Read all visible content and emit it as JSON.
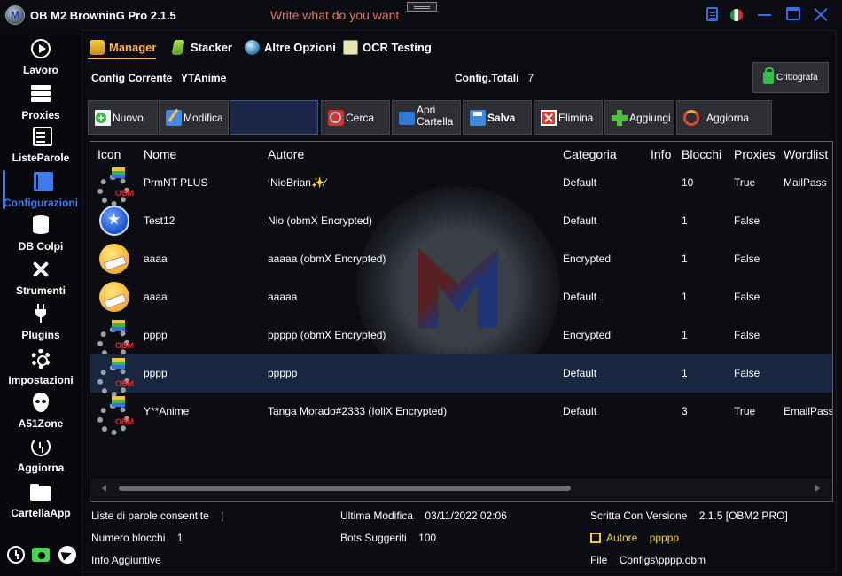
{
  "window": {
    "title": "OB M2 BrowninG Pro  2.1.5",
    "search_placeholder": "Write what do you want"
  },
  "sidebar": {
    "items": [
      {
        "label": "Lavoro",
        "icon": "play-icon"
      },
      {
        "label": "Proxies",
        "icon": "server-icon"
      },
      {
        "label": "ListeParole",
        "icon": "list-icon"
      },
      {
        "label": "Configurazioni",
        "icon": "book-icon",
        "active": true
      },
      {
        "label": "DB Colpi",
        "icon": "database-icon"
      },
      {
        "label": "Strumenti",
        "icon": "tools-icon"
      },
      {
        "label": "Plugins",
        "icon": "plug-icon"
      },
      {
        "label": "Impostazioni",
        "icon": "gear-icon"
      },
      {
        "label": "A51Zone",
        "icon": "alien-icon"
      },
      {
        "label": "Aggiorna",
        "icon": "update-icon"
      },
      {
        "label": "CartellaApp",
        "icon": "folder-icon"
      }
    ],
    "bottom_icons": [
      "history-icon",
      "camera-icon",
      "telegram-icon"
    ]
  },
  "tabs": [
    {
      "label": "Manager",
      "icon": "manager-icon",
      "active": true
    },
    {
      "label": "Stacker",
      "icon": "stacker-icon"
    },
    {
      "label": "Altre Opzioni",
      "icon": "globe-icon"
    },
    {
      "label": "OCR Testing",
      "icon": "ocr-icon"
    }
  ],
  "config": {
    "current_label": "Config Corrente",
    "current_value": "YTAnime",
    "total_label": "Config.Totali",
    "total_value": "7",
    "encrypt_label": "Crittografa"
  },
  "toolbar": {
    "nuovo": "Nuovo",
    "modifica": "Modifica",
    "cerca": "Cerca",
    "apri_line1": "Apri",
    "apri_line2": "Cartella",
    "salva": "Salva",
    "elimina": "Elimina",
    "aggiungi": "Aggiungi",
    "aggiorna": "Aggiorna"
  },
  "table": {
    "headers": {
      "icon": "Icon",
      "name": "Nome",
      "author": "Autore",
      "category": "Categoria",
      "info": "Info",
      "blocks": "Blocchi",
      "proxies": "Proxies",
      "wordlist": "Wordlist"
    },
    "rows": [
      {
        "icon": "obm-gear-icon",
        "name": "PrmNT PLUS",
        "author": "⁽NioBrian✨⁄",
        "category": "Default",
        "info": "",
        "blocks": "10",
        "proxies": "True",
        "wordlist": "MailPass"
      },
      {
        "icon": "star-icon",
        "name": "Test12",
        "author": "Nio (obmX Encrypted)",
        "category": "Default",
        "info": "",
        "blocks": "1",
        "proxies": "False",
        "wordlist": ""
      },
      {
        "icon": "smiley-icon",
        "name": "aaaa",
        "author": "aaaaa (obmX Encrypted)",
        "category": "Encrypted",
        "info": "",
        "blocks": "1",
        "proxies": "False",
        "wordlist": ""
      },
      {
        "icon": "smiley-icon",
        "name": "aaaa",
        "author": "aaaaa",
        "category": "Default",
        "info": "",
        "blocks": "1",
        "proxies": "False",
        "wordlist": ""
      },
      {
        "icon": "obm-gear-icon",
        "name": "pppp",
        "author": "ppppp (obmX Encrypted)",
        "category": "Encrypted",
        "info": "",
        "blocks": "1",
        "proxies": "False",
        "wordlist": ""
      },
      {
        "icon": "obm-gear-icon",
        "name": "pppp",
        "author": "ppppp",
        "category": "Default",
        "info": "",
        "blocks": "1",
        "proxies": "False",
        "wordlist": "",
        "selected": true
      },
      {
        "icon": "obm-gear-icon",
        "name": "Y**Anime",
        "author": "Tanga Morado#2333 (IoliX Encrypted)",
        "category": "Default",
        "info": "",
        "blocks": "3",
        "proxies": "True",
        "wordlist": "EmailPass"
      }
    ]
  },
  "details": {
    "wordlists_label": "Liste di parole consentite",
    "wordlists_value": "|",
    "blocks_label": "Numero blocchi",
    "blocks_value": "1",
    "extra_label": "Info Aggiuntive",
    "modified_label": "Ultima Modifica",
    "modified_value": "03/11/2022 02:06",
    "bots_label": "Bots Suggeriti",
    "bots_value": "100",
    "version_label": "Scritta Con Versione",
    "version_value": "2.1.5 [OBM2 PRO]",
    "author_label": "Autore",
    "author_value": "ppppp",
    "file_label": "File",
    "file_value": "Configs\\pppp.obm"
  },
  "colors": {
    "accent": "#3a7cf0",
    "tab_active": "#ffb24a",
    "author_highlight": "#f5d130"
  }
}
